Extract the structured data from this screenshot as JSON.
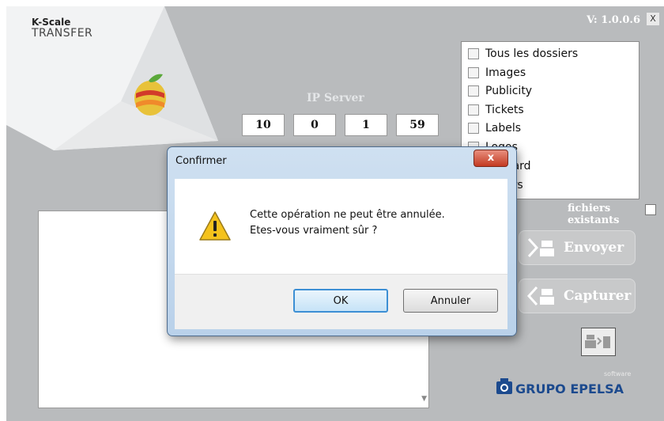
{
  "app": {
    "logo_line1": "K-Scale",
    "logo_line2": "TRANSFER",
    "version": "V: 1.0.0.6",
    "close_label": "X"
  },
  "ip": {
    "label": "IP Server",
    "octets": [
      "10",
      "0",
      "1",
      "59"
    ]
  },
  "folders": {
    "items": [
      "Tous les dossiers",
      "Images",
      "Publicity",
      "Tickets",
      "Labels",
      "Logos",
      "oard",
      "ors"
    ]
  },
  "overwrite": {
    "label": "fichiers existants"
  },
  "actions": {
    "send_label": "Envoyer",
    "capture_label": "Capturer"
  },
  "brand": {
    "software": "software",
    "name": "GRUPO EPELSA"
  },
  "dialog": {
    "title": "Confirmer",
    "close_glyph": "x",
    "line1": "Cette opération ne peut être annulée.",
    "line2": "Etes-vous vraiment sûr ?",
    "ok_label": "OK",
    "cancel_label": "Annuler"
  }
}
